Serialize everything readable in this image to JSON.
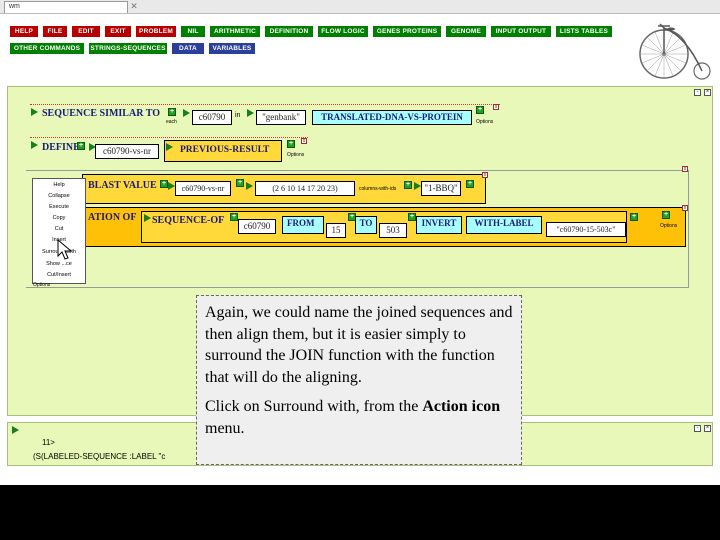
{
  "tab": {
    "title": "wm"
  },
  "menu": {
    "row1": [
      {
        "label": "HELP",
        "style": "red"
      },
      {
        "label": "FILE",
        "style": "red"
      },
      {
        "label": "EDIT",
        "style": "red"
      },
      {
        "label": "EXIT",
        "style": "red"
      },
      {
        "label": "PROBLEM",
        "style": "red"
      },
      {
        "label": "NIL",
        "style": "green"
      },
      {
        "label": "ARITHMETIC",
        "style": "green"
      },
      {
        "label": "DEFINITION",
        "style": "green"
      },
      {
        "label": "FLOW LOGIC",
        "style": "green"
      },
      {
        "label": "GENES PROTEINS",
        "style": "green"
      },
      {
        "label": "GENOME",
        "style": "green"
      },
      {
        "label": "INPUT OUTPUT",
        "style": "green"
      },
      {
        "label": "LISTS TABLES",
        "style": "green"
      }
    ],
    "row2": [
      {
        "label": "OTHER COMMANDS",
        "style": "green"
      },
      {
        "label": "STRINGS-SEQUENCES",
        "style": "green"
      },
      {
        "label": "DATA",
        "style": "blue"
      },
      {
        "label": "VARIABLES",
        "style": "blue"
      }
    ]
  },
  "box1": {
    "keyword": "SEQUENCE SIMILAR TO",
    "each_label": "each",
    "value1": "c60790",
    "in_label": "in",
    "value2": "\"genbank\"",
    "value3": "TRANSLATED-DNA-VS-PROTEIN",
    "options": "Options"
  },
  "box2": {
    "keyword": "DEFINE",
    "value1": "c60790-vs-nr",
    "value2": "PREVIOUS-RESULT",
    "options": "Options"
  },
  "box3": {
    "keyword": "BLAST VALUE",
    "value1": "c60790-vs-nr",
    "value2": "(2 6 10 14 17 20 23)",
    "sub_label": "columns-with-ids",
    "value3": "\"1-BBQ\""
  },
  "box4": {
    "keyword": "ATION OF",
    "seq_kw": "SEQUENCE-OF",
    "value1": "c60790",
    "from_kw": "FROM",
    "from_val": "15",
    "to_kw": "TO",
    "to_val": "503",
    "invert_kw": "INVERT",
    "label_kw": "WITH-LABEL",
    "label_val": "\"c60790-15-503c\"",
    "options": "Options",
    "options_under": "Options"
  },
  "context_menu": {
    "items": [
      "Help",
      "Collapse",
      "Execute",
      "Copy",
      "Cut",
      "Insert",
      "Surround with",
      "Show",
      "Cut/Insert"
    ],
    "show_suffix": "...ce"
  },
  "lower": {
    "line1": "11>",
    "line2": "(S(LABELED-SEQUENCE :LABEL \"c"
  },
  "note": {
    "p1": "Again, we could name the joined sequences and then align them, but it is easier simply to surround the JOIN function with the function that will do the aligning.",
    "p2_prefix": "Click on Surround with, from the ",
    "p2_bold": "Action icon",
    "p2_suffix": " menu."
  },
  "colors": {
    "workspace": "#e8f8b8",
    "menu_red": "#b80000",
    "menu_green": "#008000",
    "menu_blue": "#2a3f9a",
    "box_yellow": "#ffd83a",
    "box_orange": "#ffc108",
    "field_cyan": "#a8ffff"
  },
  "icons": [
    "back-arrow-icon",
    "forward-arrow-icon",
    "bicycle-logo-icon",
    "mouse-cursor-icon"
  ]
}
